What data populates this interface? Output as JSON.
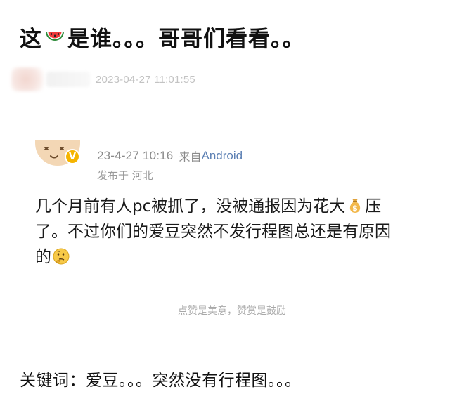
{
  "headline": {
    "before_icon": "这",
    "icon": "watermelon-icon",
    "after_icon": "是谁。。。哥哥们看看。。"
  },
  "post_meta": {
    "timestamp": "2023-04-27 11:01:55"
  },
  "comment": {
    "time": "23-4-27 10:16",
    "source_prefix": "来自",
    "source_name": "Android",
    "location": "发布于 河北",
    "badge_icon": "verified-v-icon",
    "body_line1_a": "几个月前有人pc被抓了，没被通报因为花大",
    "body_line1_icon": "money-bag-icon",
    "body_line1_b": "压",
    "body_line2": "了。不过你们的爱豆突然不发行程图总还是有原因",
    "body_line3_a": "的",
    "body_line3_icon": "thinking-face-icon"
  },
  "footer_hint": "点赞是美意，赞赏是鼓励",
  "keywords": "关键词：爱豆。。。突然没有行程图。。。",
  "colors": {
    "link_blue": "#5b7fb3",
    "meta_gray": "#8a8a8a",
    "verified_gold": "#f5b400"
  }
}
